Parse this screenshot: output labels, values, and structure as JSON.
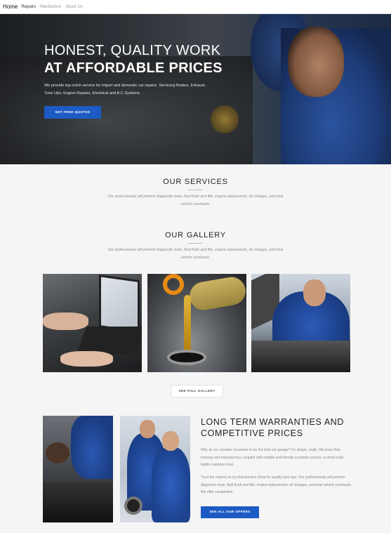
{
  "nav": {
    "home": "Home",
    "links": [
      "Repairs",
      "Manfacture",
      "About Us"
    ]
  },
  "hero": {
    "title_line1": "HONEST, QUALITY WORK",
    "title_line2": "AT AFFORDABLE PRICES",
    "description": "We provide top-notch service for import and domestic car repairs. Servicing Brakes, Exhaust, Tune Ups, Engine Repairs, Electrical and A.C Systems.",
    "cta": "GET FREE QUOTES"
  },
  "services": {
    "title": "OUR SERVICES",
    "text": "Our professionals will perform diagnostic tests, fluid flush and fills, engine replacement, oil changes, and total vehicle overhauls."
  },
  "gallery": {
    "title": "OUR GALLERY",
    "text": "Our professionals will perform diagnostic tests, fluid flush and fills, engine replacement, oil changes, and total vehicle overhauls.",
    "button": "SEE FULL GALLERY"
  },
  "warranty": {
    "title": "LONG TERM WARRANTIES AND COMPETITIVE PRICES",
    "para1": "Why do we consider ourselves to be the best car garage? It's simple, really. We know that honesty and transparency, coupled with reliable and friendly customer service, is what really builds customer trust",
    "para2": "Trust the experts at our AutoService Shop for quality tune-ups. Our professionals will perform diagnostic tests, fluid flush and fills, engine replacement, oil changes, and total vehicle overhauls. We offer competitive.",
    "cta": "SEE ALL OUR OFFERS"
  },
  "colors": {
    "accent": "#1d5bc4",
    "background": "#f5f5f5"
  }
}
